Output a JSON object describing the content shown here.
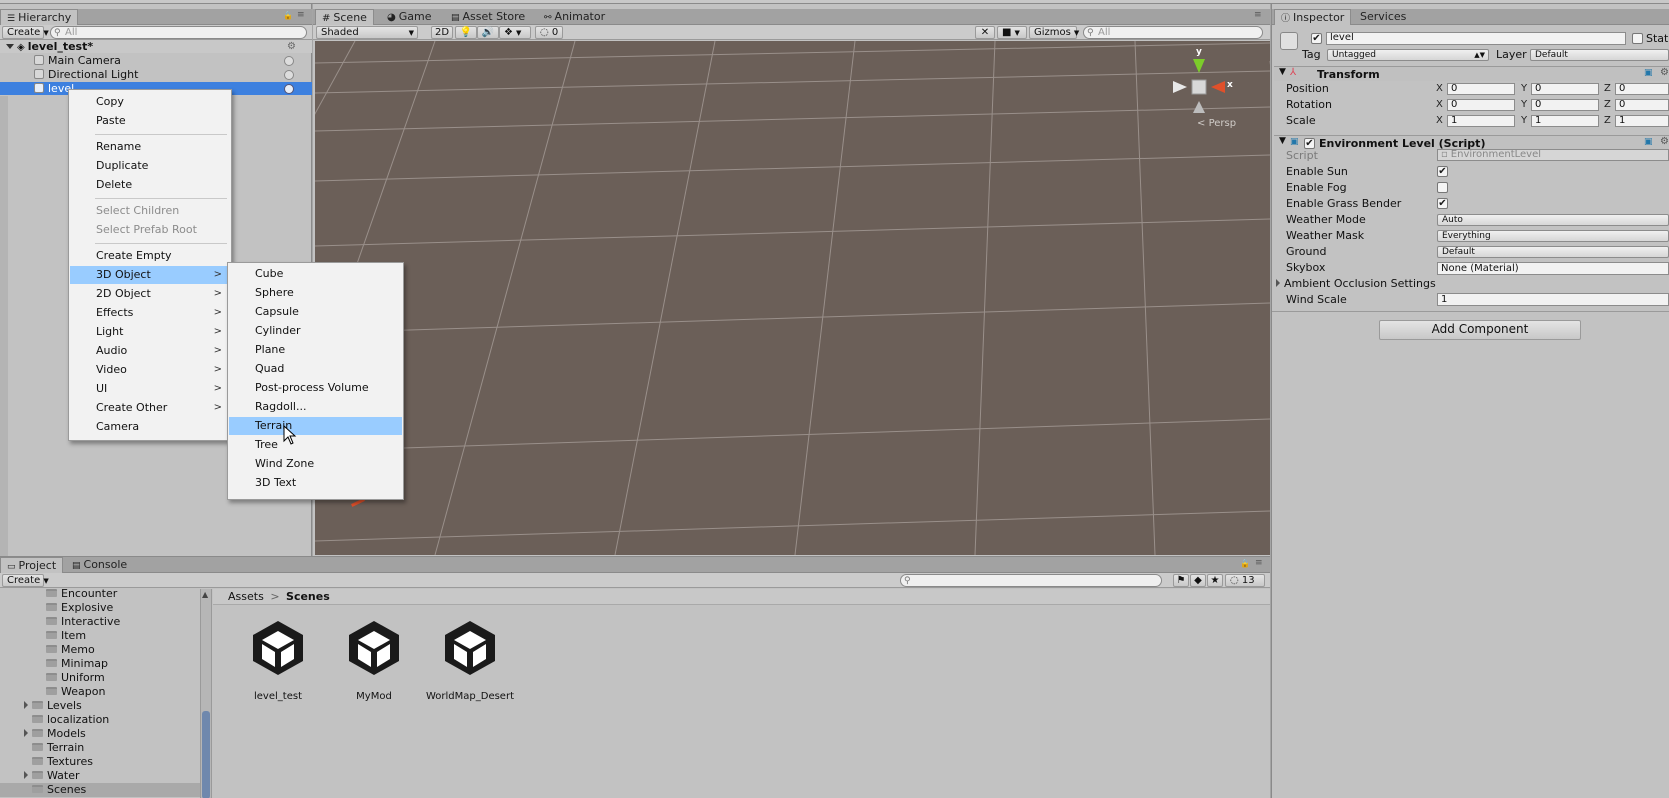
{
  "hierarchy": {
    "tab": "Hierarchy",
    "create_label": "Create",
    "search_placeholder": "All",
    "scene_name": "level_test*",
    "items": [
      {
        "label": "Main Camera"
      },
      {
        "label": "Directional Light"
      },
      {
        "label": "level"
      }
    ]
  },
  "context_menu": {
    "items": [
      {
        "label": "Copy"
      },
      {
        "label": "Paste"
      },
      {
        "label": "Rename"
      },
      {
        "label": "Duplicate"
      },
      {
        "label": "Delete"
      },
      {
        "label": "Select Children"
      },
      {
        "label": "Select Prefab Root"
      },
      {
        "label": "Create Empty"
      },
      {
        "label": "3D Object"
      },
      {
        "label": "2D Object"
      },
      {
        "label": "Effects"
      },
      {
        "label": "Light"
      },
      {
        "label": "Audio"
      },
      {
        "label": "Video"
      },
      {
        "label": "UI"
      },
      {
        "label": "Create Other"
      },
      {
        "label": "Camera"
      }
    ],
    "submenu_arrow": ">"
  },
  "submenu_3d": {
    "items": [
      {
        "label": "Cube"
      },
      {
        "label": "Sphere"
      },
      {
        "label": "Capsule"
      },
      {
        "label": "Cylinder"
      },
      {
        "label": "Plane"
      },
      {
        "label": "Quad"
      },
      {
        "label": "Post-process Volume"
      },
      {
        "label": "Ragdoll..."
      },
      {
        "label": "Terrain"
      },
      {
        "label": "Tree"
      },
      {
        "label": "Wind Zone"
      },
      {
        "label": "3D Text"
      }
    ]
  },
  "scene_view": {
    "tabs": [
      {
        "label": "Scene"
      },
      {
        "label": "Game"
      },
      {
        "label": "Asset Store"
      },
      {
        "label": "Animator"
      }
    ],
    "shading": "Shaded",
    "mode_2d": "2D",
    "effects_count": "0",
    "gizmos_label": "Gizmos",
    "search_placeholder": "All",
    "persp_label": "Persp",
    "gizmo_axes": {
      "y": "y",
      "x": "x"
    }
  },
  "inspector": {
    "tabs": [
      {
        "label": "Inspector"
      },
      {
        "label": "Services"
      }
    ],
    "object_name": "level",
    "static_label": "Static",
    "tag_label": "Tag",
    "tag_value": "Untagged",
    "layer_label": "Layer",
    "layer_value": "Default",
    "transform": {
      "title": "Transform",
      "rows": [
        {
          "label": "Position",
          "x": "0",
          "y": "0",
          "z": "0"
        },
        {
          "label": "Rotation",
          "x": "0",
          "y": "0",
          "z": "0"
        },
        {
          "label": "Scale",
          "x": "1",
          "y": "1",
          "z": "1"
        }
      ],
      "axis_x": "X",
      "axis_y": "Y",
      "axis_z": "Z"
    },
    "script_component": {
      "title": "Environment Level (Script)",
      "script_label": "Script",
      "script_value": "EnvironmentLevel",
      "enable_sun_label": "Enable Sun",
      "enable_sun": true,
      "enable_fog_label": "Enable Fog",
      "enable_fog": false,
      "enable_grass_label": "Enable Grass Bender",
      "enable_grass": true,
      "weather_mode_label": "Weather Mode",
      "weather_mode_value": "Auto",
      "weather_mask_label": "Weather Mask",
      "weather_mask_value": "Everything",
      "ground_label": "Ground",
      "ground_value": "Default",
      "skybox_label": "Skybox",
      "skybox_value": "None (Material)",
      "ao_label": "Ambient Occlusion Settings",
      "wind_scale_label": "Wind Scale",
      "wind_scale_value": "1"
    },
    "add_component_label": "Add Component"
  },
  "project": {
    "tabs": [
      {
        "label": "Project"
      },
      {
        "label": "Console"
      }
    ],
    "create_label": "Create",
    "hidden_count": "13",
    "tree": [
      {
        "label": "Encounter"
      },
      {
        "label": "Explosive"
      },
      {
        "label": "Interactive"
      },
      {
        "label": "Item"
      },
      {
        "label": "Memo"
      },
      {
        "label": "Minimap"
      },
      {
        "label": "Uniform"
      },
      {
        "label": "Weapon"
      },
      {
        "label": "Levels"
      },
      {
        "label": "localization"
      },
      {
        "label": "Models"
      },
      {
        "label": "Terrain"
      },
      {
        "label": "Textures"
      },
      {
        "label": "Water"
      },
      {
        "label": "Scenes"
      }
    ],
    "breadcrumb": {
      "root": "Assets",
      "sep": ">",
      "current": "Scenes"
    },
    "assets": [
      {
        "label": "level_test"
      },
      {
        "label": "MyMod"
      },
      {
        "label": "WorldMap_Desert"
      }
    ]
  },
  "colors": {
    "selection": "#3d80df",
    "menu_highlight": "#99ccff",
    "scene_ground": "#6b5f58",
    "gizmo_y": "#7ccc2a",
    "gizmo_x": "#e0502a"
  }
}
